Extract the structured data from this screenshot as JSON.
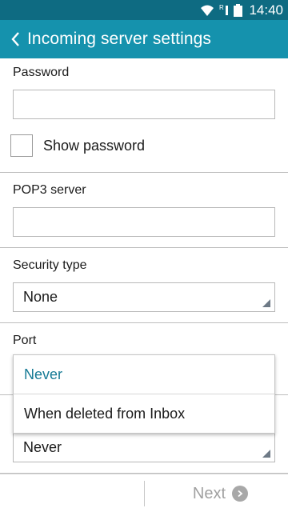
{
  "status_bar": {
    "time": "14:40",
    "signal_indicator": "R",
    "icons": [
      "wifi-icon",
      "signal-icon",
      "battery-icon"
    ]
  },
  "app_bar": {
    "title": "Incoming server settings",
    "back_icon": "chevron-left-icon"
  },
  "form": {
    "password": {
      "label": "Password",
      "value": ""
    },
    "show_password": {
      "label": "Show password",
      "checked": false
    },
    "pop3_server": {
      "label": "POP3 server",
      "value": ""
    },
    "security_type": {
      "label": "Security type",
      "value": "None"
    },
    "port": {
      "label": "Port"
    },
    "delete_email": {
      "value": "Never"
    }
  },
  "dropdown": {
    "options": [
      "Never",
      "When deleted from Inbox"
    ],
    "selected": "Never"
  },
  "bottom_bar": {
    "next_label": "Next",
    "next_icon": "chevron-right-circle-icon"
  },
  "colors": {
    "status_bar": "#0e6b82",
    "app_bar": "#1592ad",
    "selected_option": "#157a95",
    "disabled_text": "#a0a0a0"
  }
}
